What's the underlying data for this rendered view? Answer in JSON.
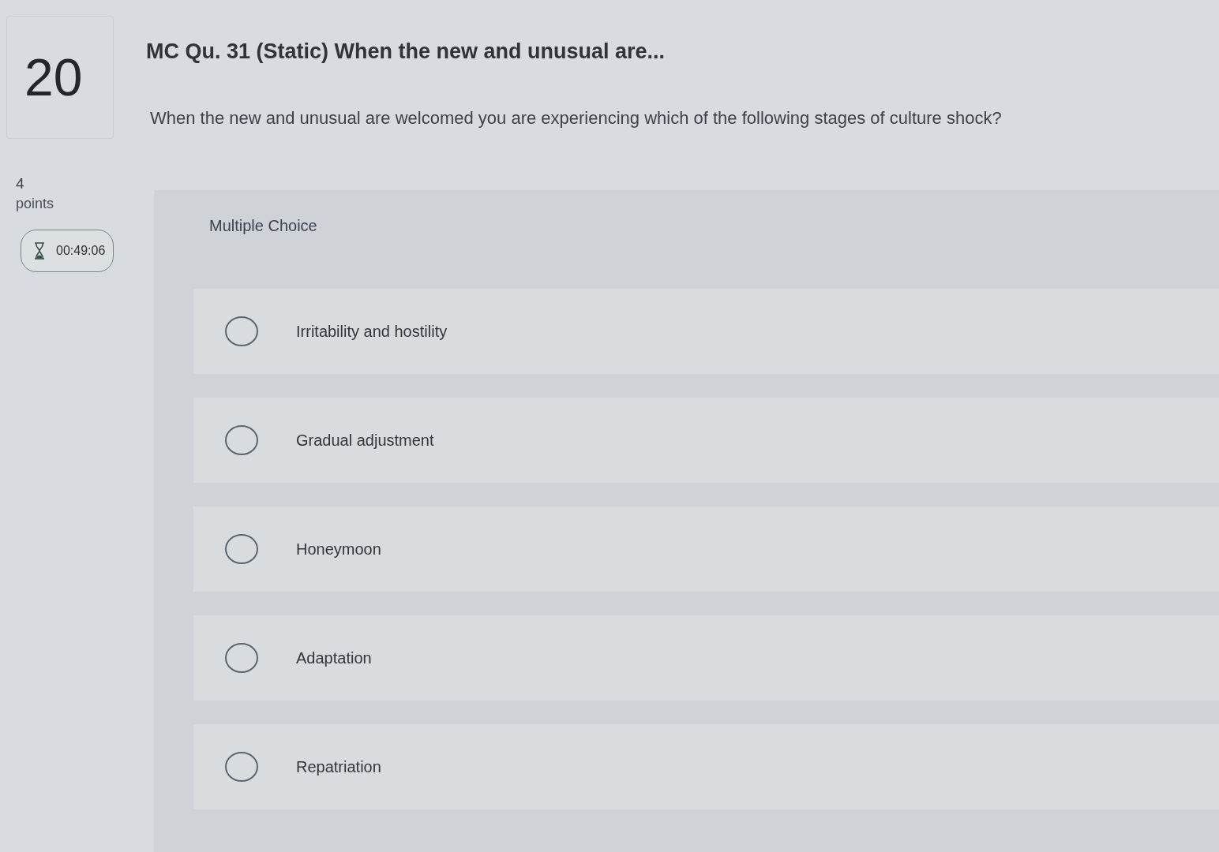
{
  "question_number": "20",
  "points": {
    "value": "4",
    "label": "points"
  },
  "timer": {
    "time": "00:49:06"
  },
  "question": {
    "title": "MC Qu. 31 (Static) When the new and unusual are...",
    "text": "When the new and unusual are welcomed you are experiencing which of the following stages of culture shock?"
  },
  "answer_panel": {
    "type_label": "Multiple Choice",
    "options": [
      {
        "label": "Irritability and hostility",
        "selected": false
      },
      {
        "label": "Gradual adjustment",
        "selected": false
      },
      {
        "label": "Honeymoon",
        "selected": false
      },
      {
        "label": "Adaptation",
        "selected": false
      },
      {
        "label": "Repatriation",
        "selected": false
      }
    ]
  }
}
